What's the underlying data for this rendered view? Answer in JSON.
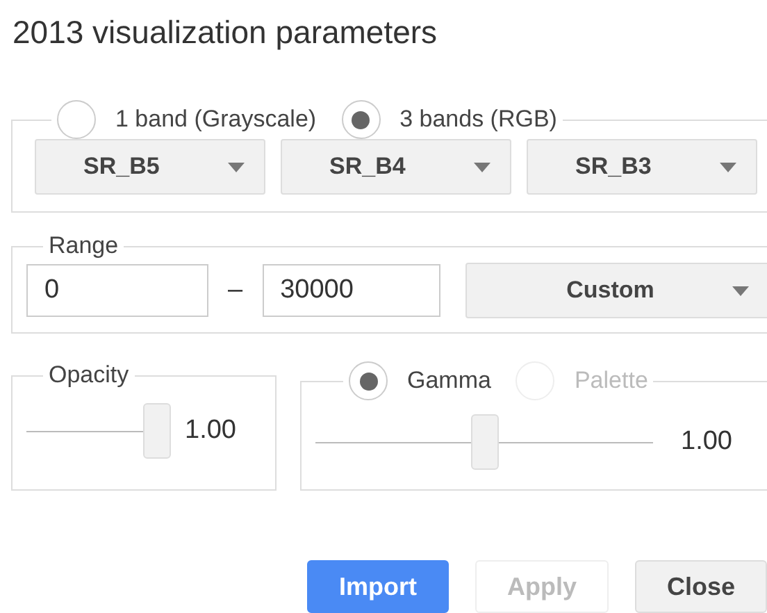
{
  "title": "2013 visualization parameters",
  "band_modes": [
    {
      "label": "1 band (Grayscale)",
      "selected": false,
      "disabled": false
    },
    {
      "label": "3 bands (RGB)",
      "selected": true,
      "disabled": false
    }
  ],
  "bands": [
    "SR_B5",
    "SR_B4",
    "SR_B3"
  ],
  "range": {
    "legend": "Range",
    "min": "0",
    "separator": "–",
    "max": "30000",
    "mode": "Custom"
  },
  "opacity": {
    "legend": "Opacity",
    "level": 0.9,
    "reading": "1.00"
  },
  "stretch_modes": [
    {
      "label": "Gamma",
      "selected": true,
      "disabled": false
    },
    {
      "label": "Palette",
      "selected": false,
      "disabled": true
    }
  ],
  "gamma": {
    "level": 0.5,
    "reading": "1.00"
  },
  "buttons": [
    {
      "label": "Import",
      "kind": "primary",
      "disabled": false
    },
    {
      "label": "Apply",
      "kind": "secondary",
      "disabled": true
    },
    {
      "label": "Close",
      "kind": "secondary",
      "disabled": false
    }
  ]
}
